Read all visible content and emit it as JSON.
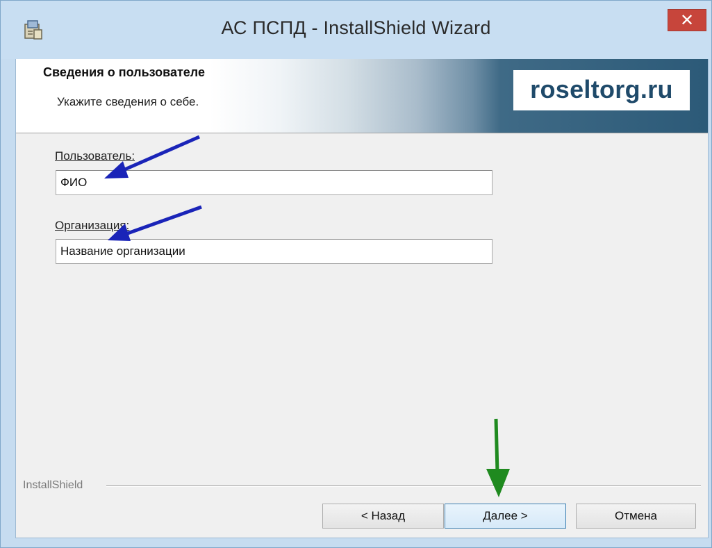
{
  "window": {
    "title": "АС ПСПД - InstallShield Wizard",
    "close_glyph": "✕",
    "app_icon": "installer-icon"
  },
  "banner": {
    "title": "Сведения о пользователе",
    "subtitle": "Укажите сведения о себе.",
    "logo_text": "roseltorg.ru"
  },
  "form": {
    "user_label": "Пользователь:",
    "user_value": "ФИО",
    "org_label": "Организация:",
    "org_value": "Название организации"
  },
  "footer": {
    "brand": "InstallShield",
    "back_label": "< Назад",
    "next_label": "Далее >",
    "cancel_label": "Отмена"
  },
  "colors": {
    "annotation_arrow_blue": "#1a24b8",
    "annotation_arrow_green": "#1f8a1f",
    "close_button": "#c7453b"
  }
}
